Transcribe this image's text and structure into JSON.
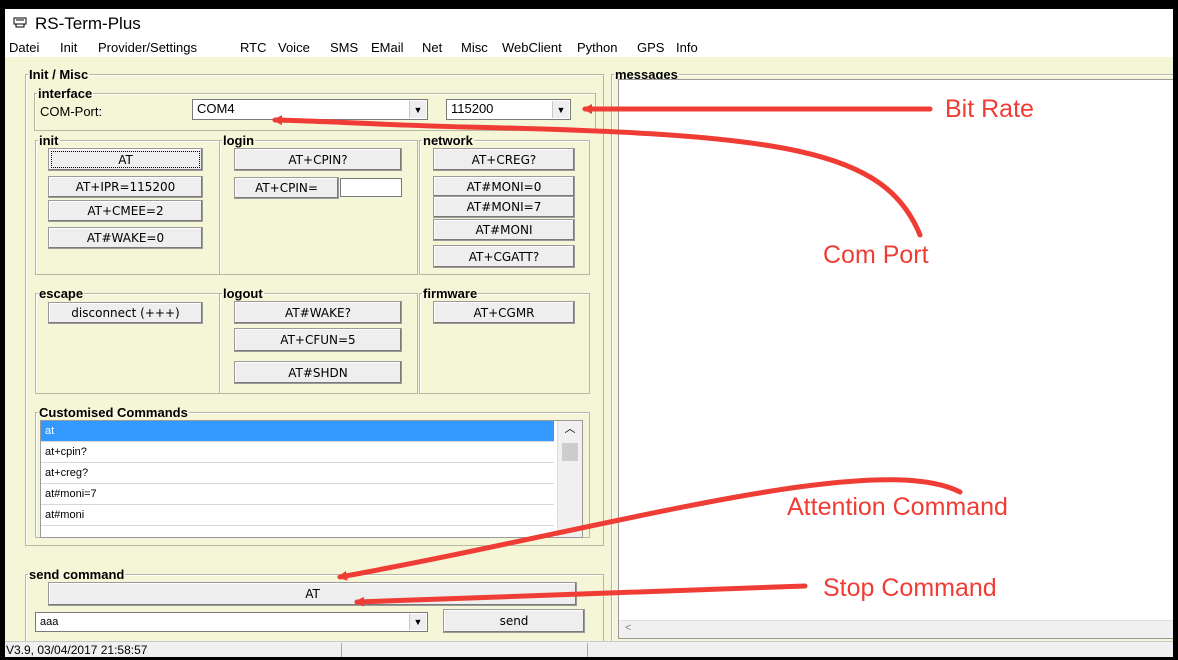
{
  "window": {
    "title": "RS-Term-Plus"
  },
  "menu": [
    "Datei",
    "Init",
    "Provider/Settings",
    "RTC",
    "Voice",
    "SMS",
    "EMail",
    "Net",
    "Misc",
    "WebClient",
    "Python",
    "GPS",
    "Info"
  ],
  "init_misc": {
    "title": "Init / Misc",
    "interface": {
      "title": "interface",
      "com_label": "COM-Port:",
      "com_value": "COM4",
      "baud_value": "115200"
    },
    "init": {
      "title": "init",
      "buttons": [
        "AT",
        "AT+IPR=115200",
        "AT+CMEE=2",
        "AT#WAKE=0"
      ]
    },
    "login": {
      "title": "login",
      "buttons": [
        "AT+CPIN?",
        "AT+CPIN="
      ],
      "pin_value": ""
    },
    "network": {
      "title": "network",
      "buttons": [
        "AT+CREG?",
        "AT#MONI=0",
        "AT#MONI=7",
        "AT#MONI",
        "AT+CGATT?"
      ]
    },
    "escape": {
      "title": "escape",
      "buttons": [
        "disconnect (+++)"
      ]
    },
    "logout": {
      "title": "logout",
      "buttons": [
        "AT#WAKE?",
        "AT+CFUN=5",
        "AT#SHDN"
      ]
    },
    "firmware": {
      "title": "firmware",
      "buttons": [
        "AT+CGMR"
      ]
    },
    "custom": {
      "title": "Customised Commands",
      "items": [
        "at",
        "at+cpin?",
        "at+creg?",
        "at#moni=7",
        "at#moni"
      ],
      "selected": 0
    }
  },
  "send": {
    "title": "send command",
    "last_command": "AT",
    "input_value": "aaa",
    "send_label": "send"
  },
  "messages": {
    "title": "messages"
  },
  "status": {
    "version": "V3.9, 03/04/2017 21:58:57"
  },
  "annotations": {
    "bit_rate": "Bit Rate",
    "com_port": "Com Port",
    "attention": "Attention Command",
    "stop": "Stop Command"
  },
  "colors": {
    "annotation": "#ef3d35",
    "selection": "#3399ff",
    "panel": "#f5f5d8"
  }
}
